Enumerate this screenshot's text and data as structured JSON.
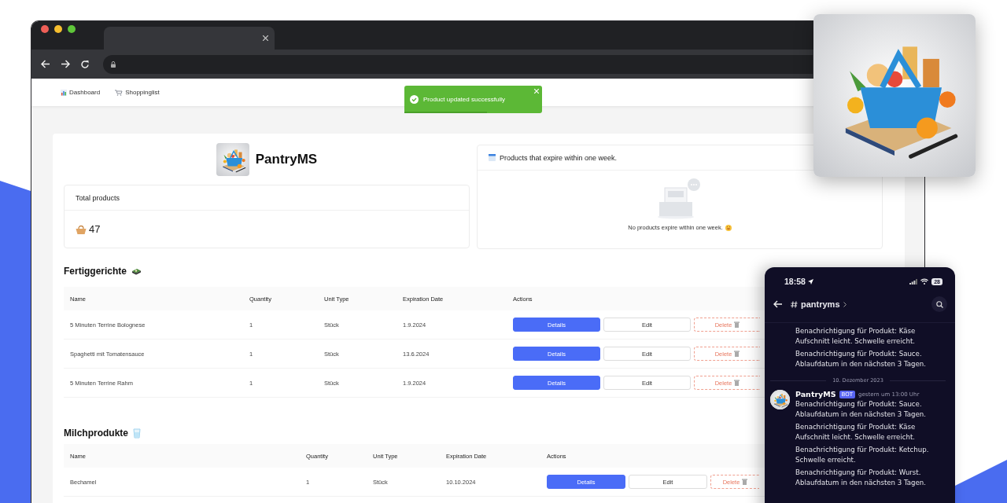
{
  "nav": [
    {
      "label": "Dashboard",
      "kind": "chart"
    },
    {
      "label": "Shoppinglist",
      "kind": "cart"
    }
  ],
  "toast": {
    "message": "Product updated successfully",
    "level": 0.6
  },
  "app": {
    "title": "PantryMS"
  },
  "total_card": {
    "title": "Total products",
    "count": "47"
  },
  "expiry_card": {
    "title": "Products that expire within one week.",
    "empty_message": "No products expire within one week."
  },
  "sections": [
    {
      "title": "Fertiggerichte",
      "kind": "meal",
      "columns": [
        "Name",
        "Quantity",
        "Unit Type",
        "Expiration Date",
        "Actions"
      ],
      "rows": [
        {
          "cells": [
            "5 Minuten Terrine Bolognese",
            "1",
            "Stück",
            "1.9.2024"
          ],
          "actions": [
            "Details",
            "Edit",
            "Delete"
          ]
        },
        {
          "cells": [
            "Spaghetti mit Tomatensauce",
            "1",
            "Stück",
            "13.6.2024"
          ],
          "actions": [
            "Details",
            "Edit",
            "Delete"
          ]
        },
        {
          "cells": [
            "5 Minuten Terrine Rahm",
            "1",
            "Stück",
            "1.9.2024"
          ],
          "actions": [
            "Details",
            "Edit",
            "Delete"
          ]
        }
      ]
    },
    {
      "title": "Milchprodukte",
      "kind": "glass",
      "columns": [
        "Name",
        "Quantity",
        "Unit Type",
        "Expiration Date",
        "Actions"
      ],
      "rows": [
        {
          "cells": [
            "Bechamel",
            "1",
            "Stück",
            "10.10.2024"
          ],
          "actions": [
            "Details",
            "Edit",
            "Delete"
          ]
        }
      ]
    }
  ],
  "phone": {
    "time": "18:58",
    "battery": "28",
    "channel": "pantryms",
    "earlier_messages": [
      "Benachrichtigung für Produkt: Käse Aufschnitt leicht. Schwelle erreicht.",
      "Benachrichtigung für Produkt: Sauce. Ablaufdatum in den nächsten 3 Tagen."
    ],
    "date_divider": "10. Dezember 2023",
    "author": "PantryMS",
    "badge": "BOT",
    "timestamp": "gestern um 13:00 Uhr",
    "messages": [
      "Benachrichtigung für Produkt: Sauce. Ablaufdatum in den nächsten 3 Tagen.",
      "Benachrichtigung für Produkt: Käse Aufschnitt leicht. Schwelle erreicht.",
      "Benachrichtigung für Produkt: Ketchup. Schwelle erreicht.",
      "Benachrichtigung für Produkt: Wurst. Ablaufdatum in den nächsten 3 Tagen."
    ]
  }
}
